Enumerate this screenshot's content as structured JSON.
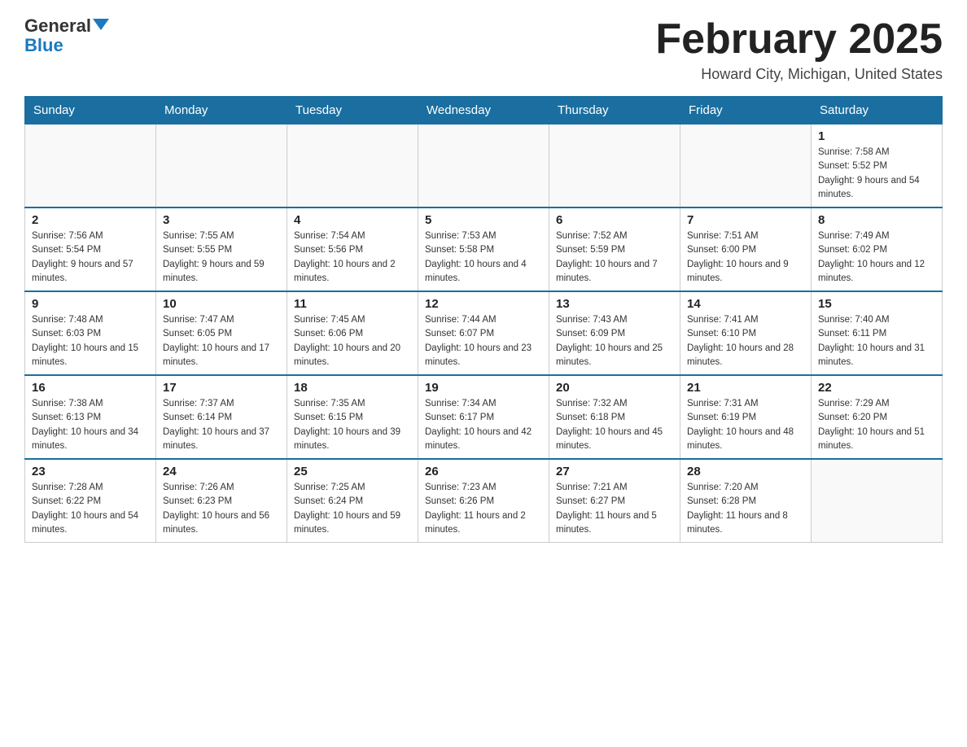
{
  "header": {
    "logo_general": "General",
    "logo_blue": "Blue",
    "month_title": "February 2025",
    "location": "Howard City, Michigan, United States"
  },
  "weekdays": [
    "Sunday",
    "Monday",
    "Tuesday",
    "Wednesday",
    "Thursday",
    "Friday",
    "Saturday"
  ],
  "weeks": [
    [
      {
        "day": "",
        "info": ""
      },
      {
        "day": "",
        "info": ""
      },
      {
        "day": "",
        "info": ""
      },
      {
        "day": "",
        "info": ""
      },
      {
        "day": "",
        "info": ""
      },
      {
        "day": "",
        "info": ""
      },
      {
        "day": "1",
        "info": "Sunrise: 7:58 AM\nSunset: 5:52 PM\nDaylight: 9 hours and 54 minutes."
      }
    ],
    [
      {
        "day": "2",
        "info": "Sunrise: 7:56 AM\nSunset: 5:54 PM\nDaylight: 9 hours and 57 minutes."
      },
      {
        "day": "3",
        "info": "Sunrise: 7:55 AM\nSunset: 5:55 PM\nDaylight: 9 hours and 59 minutes."
      },
      {
        "day": "4",
        "info": "Sunrise: 7:54 AM\nSunset: 5:56 PM\nDaylight: 10 hours and 2 minutes."
      },
      {
        "day": "5",
        "info": "Sunrise: 7:53 AM\nSunset: 5:58 PM\nDaylight: 10 hours and 4 minutes."
      },
      {
        "day": "6",
        "info": "Sunrise: 7:52 AM\nSunset: 5:59 PM\nDaylight: 10 hours and 7 minutes."
      },
      {
        "day": "7",
        "info": "Sunrise: 7:51 AM\nSunset: 6:00 PM\nDaylight: 10 hours and 9 minutes."
      },
      {
        "day": "8",
        "info": "Sunrise: 7:49 AM\nSunset: 6:02 PM\nDaylight: 10 hours and 12 minutes."
      }
    ],
    [
      {
        "day": "9",
        "info": "Sunrise: 7:48 AM\nSunset: 6:03 PM\nDaylight: 10 hours and 15 minutes."
      },
      {
        "day": "10",
        "info": "Sunrise: 7:47 AM\nSunset: 6:05 PM\nDaylight: 10 hours and 17 minutes."
      },
      {
        "day": "11",
        "info": "Sunrise: 7:45 AM\nSunset: 6:06 PM\nDaylight: 10 hours and 20 minutes."
      },
      {
        "day": "12",
        "info": "Sunrise: 7:44 AM\nSunset: 6:07 PM\nDaylight: 10 hours and 23 minutes."
      },
      {
        "day": "13",
        "info": "Sunrise: 7:43 AM\nSunset: 6:09 PM\nDaylight: 10 hours and 25 minutes."
      },
      {
        "day": "14",
        "info": "Sunrise: 7:41 AM\nSunset: 6:10 PM\nDaylight: 10 hours and 28 minutes."
      },
      {
        "day": "15",
        "info": "Sunrise: 7:40 AM\nSunset: 6:11 PM\nDaylight: 10 hours and 31 minutes."
      }
    ],
    [
      {
        "day": "16",
        "info": "Sunrise: 7:38 AM\nSunset: 6:13 PM\nDaylight: 10 hours and 34 minutes."
      },
      {
        "day": "17",
        "info": "Sunrise: 7:37 AM\nSunset: 6:14 PM\nDaylight: 10 hours and 37 minutes."
      },
      {
        "day": "18",
        "info": "Sunrise: 7:35 AM\nSunset: 6:15 PM\nDaylight: 10 hours and 39 minutes."
      },
      {
        "day": "19",
        "info": "Sunrise: 7:34 AM\nSunset: 6:17 PM\nDaylight: 10 hours and 42 minutes."
      },
      {
        "day": "20",
        "info": "Sunrise: 7:32 AM\nSunset: 6:18 PM\nDaylight: 10 hours and 45 minutes."
      },
      {
        "day": "21",
        "info": "Sunrise: 7:31 AM\nSunset: 6:19 PM\nDaylight: 10 hours and 48 minutes."
      },
      {
        "day": "22",
        "info": "Sunrise: 7:29 AM\nSunset: 6:20 PM\nDaylight: 10 hours and 51 minutes."
      }
    ],
    [
      {
        "day": "23",
        "info": "Sunrise: 7:28 AM\nSunset: 6:22 PM\nDaylight: 10 hours and 54 minutes."
      },
      {
        "day": "24",
        "info": "Sunrise: 7:26 AM\nSunset: 6:23 PM\nDaylight: 10 hours and 56 minutes."
      },
      {
        "day": "25",
        "info": "Sunrise: 7:25 AM\nSunset: 6:24 PM\nDaylight: 10 hours and 59 minutes."
      },
      {
        "day": "26",
        "info": "Sunrise: 7:23 AM\nSunset: 6:26 PM\nDaylight: 11 hours and 2 minutes."
      },
      {
        "day": "27",
        "info": "Sunrise: 7:21 AM\nSunset: 6:27 PM\nDaylight: 11 hours and 5 minutes."
      },
      {
        "day": "28",
        "info": "Sunrise: 7:20 AM\nSunset: 6:28 PM\nDaylight: 11 hours and 8 minutes."
      },
      {
        "day": "",
        "info": ""
      }
    ]
  ]
}
